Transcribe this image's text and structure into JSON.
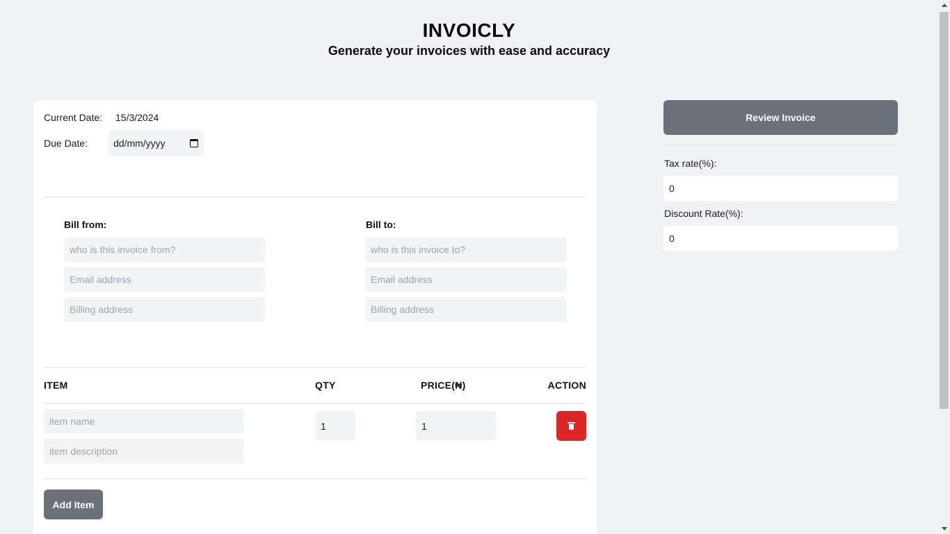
{
  "header": {
    "title": "INVOICLY",
    "subtitle": "Generate your invoices with ease and accuracy"
  },
  "dates": {
    "current_label": "Current Date:",
    "current_value": "15/3/2024",
    "due_label": "Due Date:",
    "due_placeholder": "dd/mm/yyyy"
  },
  "bill_from": {
    "label": "Bill from:",
    "name_placeholder": "who is this invoice from?",
    "email_placeholder": "Email address",
    "address_placeholder": "Billing address"
  },
  "bill_to": {
    "label": "Bill to:",
    "name_placeholder": "who is this invoice to?",
    "email_placeholder": "Email address",
    "address_placeholder": "Billing address"
  },
  "items_table": {
    "headers": [
      "ITEM",
      "QTY",
      "PRICE(₦)",
      "ACTION"
    ],
    "rows": [
      {
        "name_placeholder": "item name",
        "description_placeholder": "item description",
        "qty": "1",
        "price": "1"
      }
    ],
    "add_label": "Add Item"
  },
  "sidebar": {
    "review_label": "Review Invoice",
    "tax_label": "Tax rate(%):",
    "tax_value": "0",
    "discount_label": "Discount Rate(%):",
    "discount_value": "0"
  },
  "colors": {
    "background": "#f1f2f6",
    "button_gray": "#6b717b",
    "delete_red": "#dc2626",
    "input_fill": "#f3f4f6"
  }
}
